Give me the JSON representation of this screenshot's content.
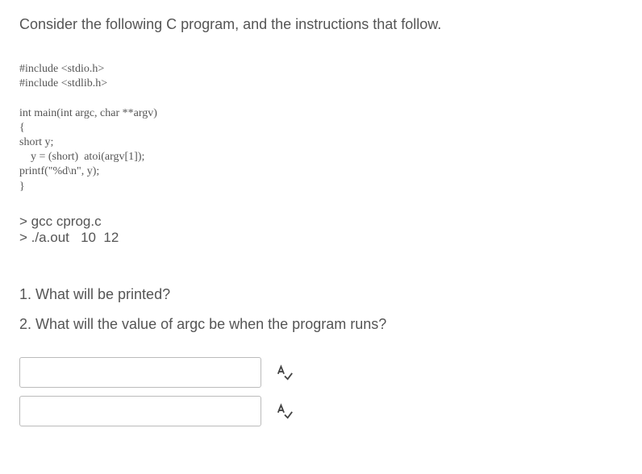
{
  "intro": "Consider the following C program, and the instructions that follow.",
  "code": "#include <stdio.h>\n#include <stdlib.h>\n\nint main(int argc, char **argv)\n{\nshort y;\n    y = (short)  atoi(argv[1]);\nprintf(\"%d\\n\", y);\n}",
  "shell": "> gcc cprog.c\n> ./a.out   10  12",
  "questions": {
    "q1": "1. What will be printed?",
    "q2": "2. What will the value of argc be when the program runs?"
  },
  "answers": {
    "a1": "",
    "a2": ""
  }
}
